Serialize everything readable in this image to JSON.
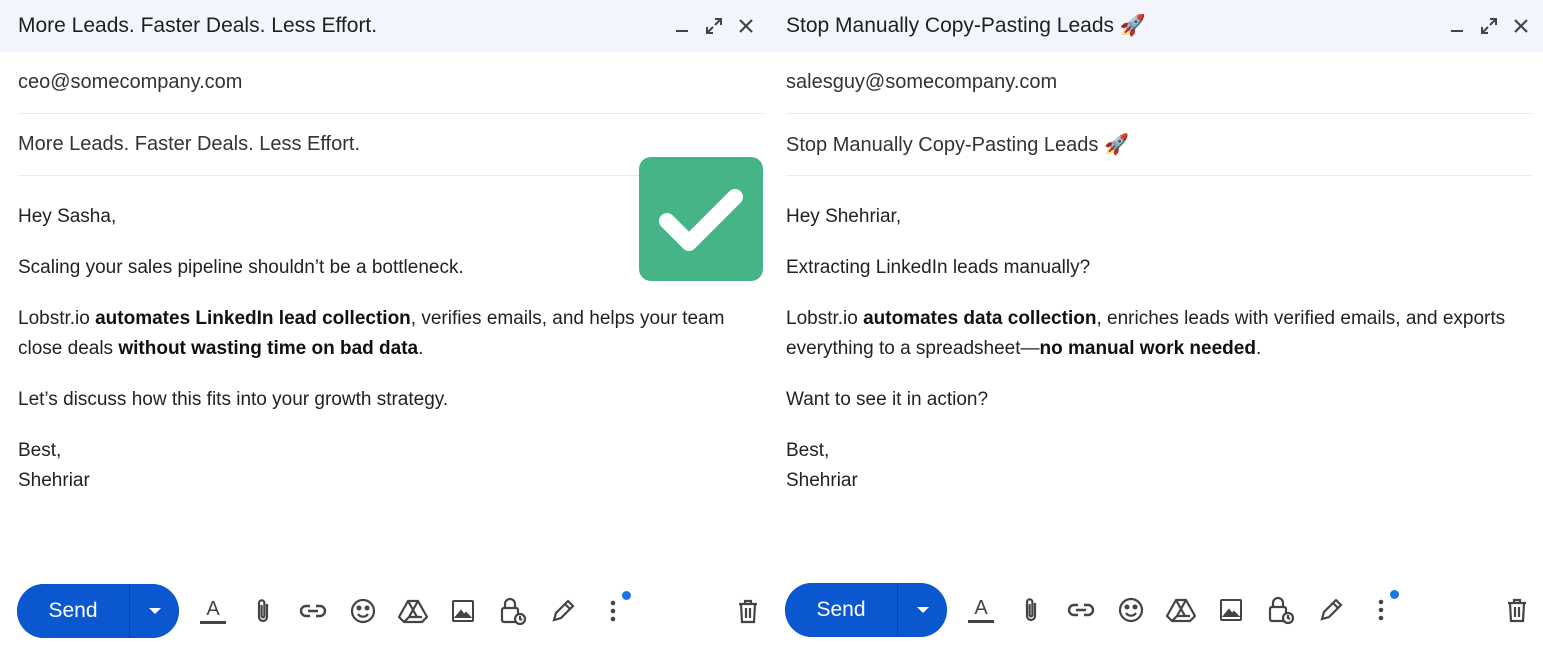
{
  "left": {
    "title": "More Leads. Faster Deals. Less Effort.",
    "to": "ceo@somecompany.com",
    "subject": "More Leads. Faster Deals. Less Effort.",
    "greeting": "Hey Sasha,",
    "p1": "Scaling your sales pipeline shouldn’t be a bottleneck.",
    "p2_a": "Lobstr.io ",
    "p2_b": "automates LinkedIn lead collection",
    "p2_c": ", verifies emails, and helps your team close deals ",
    "p2_d": "without wasting time on bad data",
    "p2_e": ".",
    "p3": "Let’s discuss how this fits into your growth strategy.",
    "signoff": "Best,",
    "name": "Shehriar",
    "send_label": "Send"
  },
  "right": {
    "title": "Stop Manually Copy-Pasting Leads 🚀",
    "to": "salesguy@somecompany.com",
    "subject": "Stop Manually Copy-Pasting Leads 🚀",
    "greeting": "Hey Shehriar,",
    "p1": "Extracting LinkedIn leads manually?",
    "p2_a": "Lobstr.io ",
    "p2_b": "automates data collection",
    "p2_c": ", enriches leads with verified emails, and exports everything to a spreadsheet—",
    "p2_d": "no manual work needed",
    "p2_e": ".",
    "p3": "Want to see it in action?",
    "signoff": "Best,",
    "name": "Shehriar",
    "send_label": "Send"
  },
  "colors": {
    "send": "#0b57d0",
    "header_bg": "#f2f6fc",
    "check_bg": "#45b486",
    "dot": "#1a73e8"
  },
  "icons": [
    "minimize-icon",
    "expand-icon",
    "close-icon",
    "format-text-icon",
    "attach-icon",
    "link-icon",
    "emoji-icon",
    "drive-icon",
    "photo-icon",
    "confidential-icon",
    "signature-icon",
    "more-icon",
    "trash-icon"
  ]
}
